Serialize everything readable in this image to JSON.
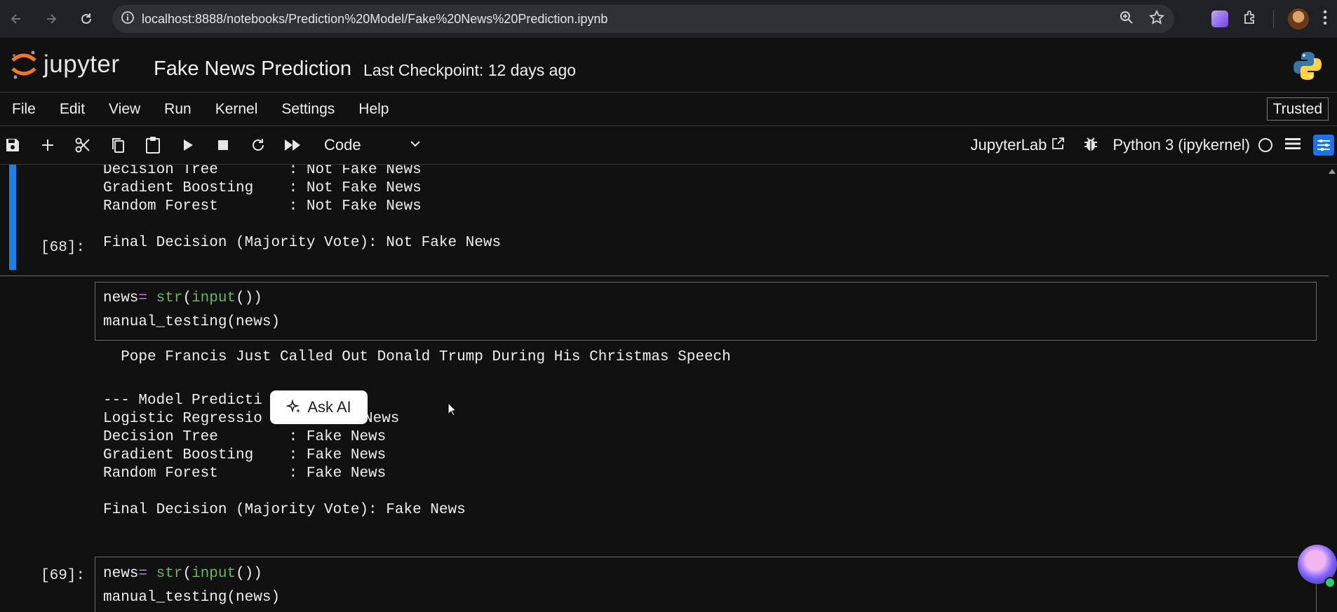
{
  "browser": {
    "url": "localhost:8888/notebooks/Prediction%20Model/Fake%20News%20Prediction.ipynb"
  },
  "header": {
    "logo_text": "jupyter",
    "title": "Fake News Prediction",
    "checkpoint": "Last Checkpoint: 12 days ago"
  },
  "menu": {
    "items": [
      "File",
      "Edit",
      "View",
      "Run",
      "Kernel",
      "Settings",
      "Help"
    ],
    "trusted": "Trusted"
  },
  "toolbar": {
    "cell_type": "Code",
    "jupyterlab": "JupyterLab",
    "kernel": "Python 3 (ipykernel)"
  },
  "cells": {
    "prev_output": [
      "Decision Tree        : Not Fake News",
      "Gradient Boosting    : Not Fake News",
      "Random Forest        : Not Fake News",
      "Final Decision (Majority Vote): Not Fake News"
    ],
    "cell68": {
      "prompt": "[68]:",
      "line1_var": "news",
      "line1_eq": "=",
      "line1_fn": "str",
      "line1_open": "(",
      "line1_fn2": "input",
      "line1_close": "())",
      "line2": "manual_testing(news)",
      "output": [
        "  Pope Francis Just Called Out Donald Trump During His Christmas Speech",
        "--- Model Predicti",
        "Logistic Regressio",
        "News",
        "Decision Tree        : Fake News",
        "Gradient Boosting    : Fake News",
        "Random Forest        : Fake News",
        "Final Decision (Majority Vote): Fake News"
      ]
    },
    "cell69": {
      "prompt": "[69]:",
      "line1_var": "news",
      "line1_eq": "=",
      "line1_fn": "str",
      "line1_open": "(",
      "line1_fn2": "input",
      "line1_close": "())",
      "line2": "manual_testing(news)"
    }
  },
  "ask_ai": "Ask AI"
}
